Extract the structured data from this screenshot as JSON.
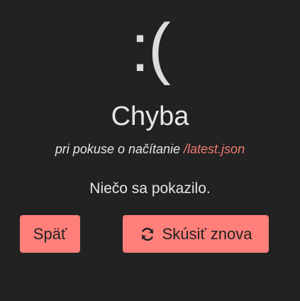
{
  "error": {
    "face": ":(",
    "title": "Chyba",
    "subtitle_prefix": "pri pokuse o načítanie ",
    "subtitle_path": "/latest.json",
    "message": "Niečo sa pokazilo."
  },
  "actions": {
    "back_label": "Späť",
    "retry_label": "Skúsiť znova",
    "retry_icon": "refresh-icon"
  },
  "colors": {
    "background": "#222222",
    "text": "#e6e6e6",
    "accent": "#ff7f7a",
    "path": "#f07a72"
  }
}
